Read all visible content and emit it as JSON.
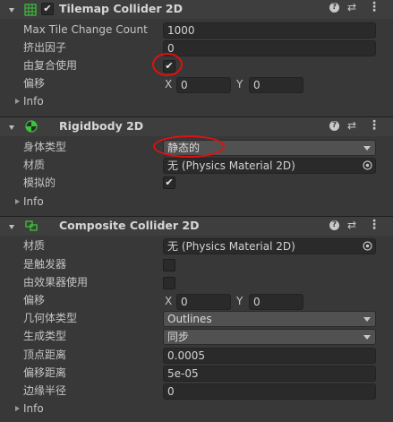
{
  "tilemap_collider": {
    "title": "Tilemap Collider 2D",
    "max_tile_label": "Max Tile Change Count",
    "max_tile_value": "1000",
    "extrusion_label": "挤出因子",
    "extrusion_value": "0",
    "used_by_composite_label": "由复合使用",
    "used_by_composite_checked": true,
    "offset_label": "偏移",
    "offset_x_label": "X",
    "offset_x": "0",
    "offset_y_label": "Y",
    "offset_y": "0",
    "info_label": "Info"
  },
  "rigidbody": {
    "title": "Rigidbody 2D",
    "body_type_label": "身体类型",
    "body_type_value": "静态的",
    "material_label": "材质",
    "material_value": "无 (Physics Material 2D)",
    "simulated_label": "模拟的",
    "simulated_checked": true,
    "info_label": "Info"
  },
  "composite_collider": {
    "title": "Composite Collider 2D",
    "material_label": "材质",
    "material_value": "无 (Physics Material 2D)",
    "is_trigger_label": "是触发器",
    "used_by_effector_label": "由效果器使用",
    "offset_label": "偏移",
    "offset_x_label": "X",
    "offset_x": "0",
    "offset_y_label": "Y",
    "offset_y": "0",
    "geometry_type_label": "几何体类型",
    "geometry_type_value": "Outlines",
    "generation_type_label": "生成类型",
    "generation_type_value": "同步",
    "vertex_distance_label": "顶点距离",
    "vertex_distance_value": "0.0005",
    "offset_distance_label": "偏移距离",
    "offset_distance_value": "5e-05",
    "edge_radius_label": "边缘半径",
    "edge_radius_value": "0",
    "info_label": "Info"
  },
  "colors": {
    "background": "#383838",
    "header": "#3e3e3e",
    "field": "#2a2a2a",
    "highlight_circle": "#e01010"
  }
}
